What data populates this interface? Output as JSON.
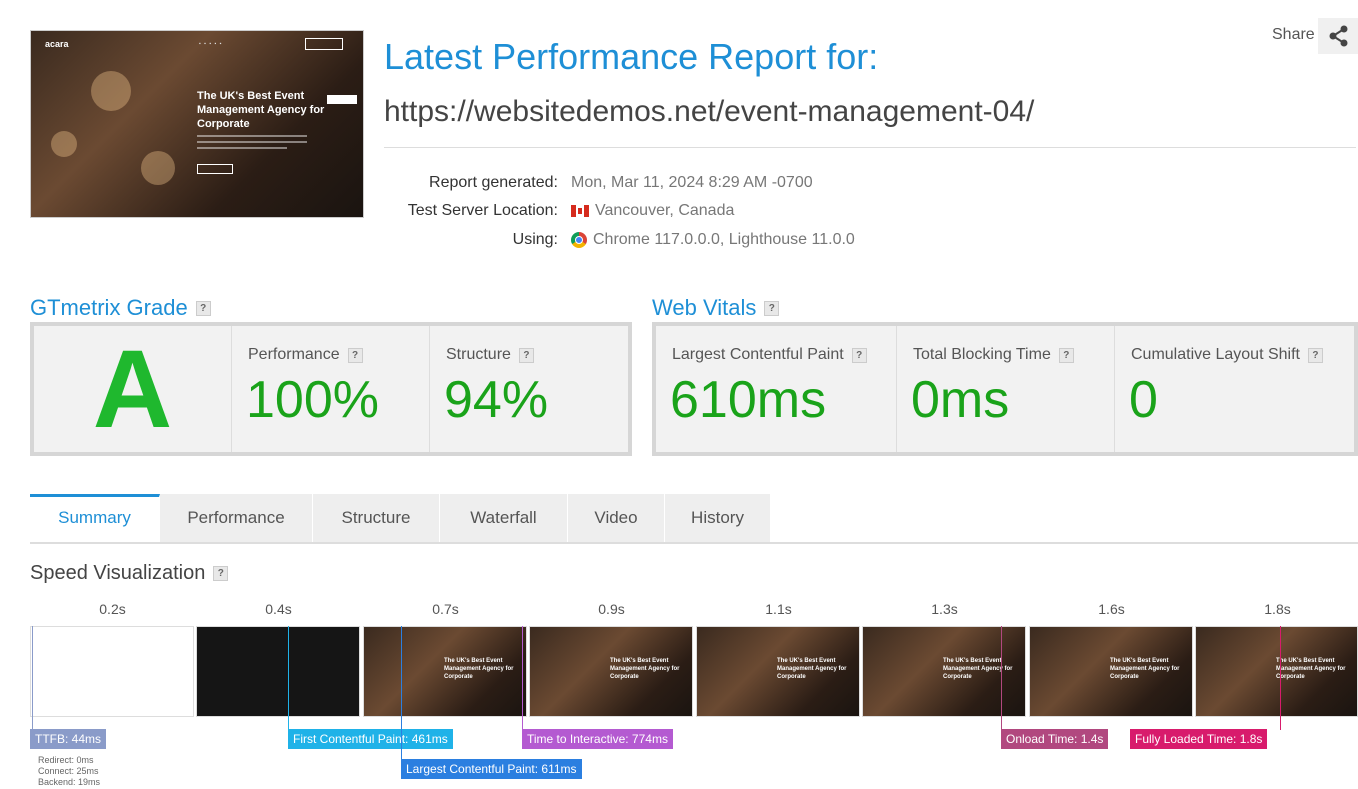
{
  "header": {
    "title": "Latest Performance Report for:",
    "url": "https://websitedemos.net/event-management-04/",
    "share_label": "Share",
    "meta": [
      {
        "label": "Report generated:",
        "value": "Mon, Mar 11, 2024 8:29 AM -0700",
        "icon": ""
      },
      {
        "label": "Test Server Location:",
        "value": "Vancouver, Canada",
        "icon": "canada-flag-icon"
      },
      {
        "label": "Using:",
        "value": "Chrome 117.0.0.0, Lighthouse 11.0.0",
        "icon": "chrome-icon"
      }
    ]
  },
  "thumbnail": {
    "logo": "acara",
    "headline": "The UK's Best Event Management Agency for Corporate"
  },
  "grade": {
    "heading": "GTmetrix Grade",
    "letter": "A",
    "performance_label": "Performance",
    "performance_value": "100%",
    "structure_label": "Structure",
    "structure_value": "94%"
  },
  "vitals": {
    "heading": "Web Vitals",
    "items": [
      {
        "label": "Largest Contentful Paint",
        "value": "610ms"
      },
      {
        "label": "Total Blocking Time",
        "value": "0ms"
      },
      {
        "label": "Cumulative Layout Shift",
        "value": "0"
      }
    ]
  },
  "tabs": [
    "Summary",
    "Performance",
    "Structure",
    "Waterfall",
    "Video",
    "History"
  ],
  "speed_visualization": {
    "heading": "Speed Visualization",
    "time_labels": [
      "0.2s",
      "0.4s",
      "0.7s",
      "0.9s",
      "1.1s",
      "1.3s",
      "1.6s",
      "1.8s"
    ],
    "frame_text": "The UK's Best Event Management Agency for Corporate",
    "markers": [
      {
        "label": "TTFB: 44ms",
        "color": "#8a9bc9"
      },
      {
        "label": "First Contentful Paint: 461ms",
        "color": "#1fb2e8"
      },
      {
        "label": "Largest Contentful Paint: 611ms",
        "color": "#2b7fe0"
      },
      {
        "label": "Time to Interactive: 774ms",
        "color": "#b45ad1"
      },
      {
        "label": "Onload Time: 1.4s",
        "color": "#b1487f"
      },
      {
        "label": "Fully Loaded Time: 1.8s",
        "color": "#d81b6c"
      }
    ],
    "timing_details": [
      "Redirect: 0ms",
      "Connect: 25ms",
      "Backend: 19ms"
    ]
  },
  "help_glyph": "?"
}
